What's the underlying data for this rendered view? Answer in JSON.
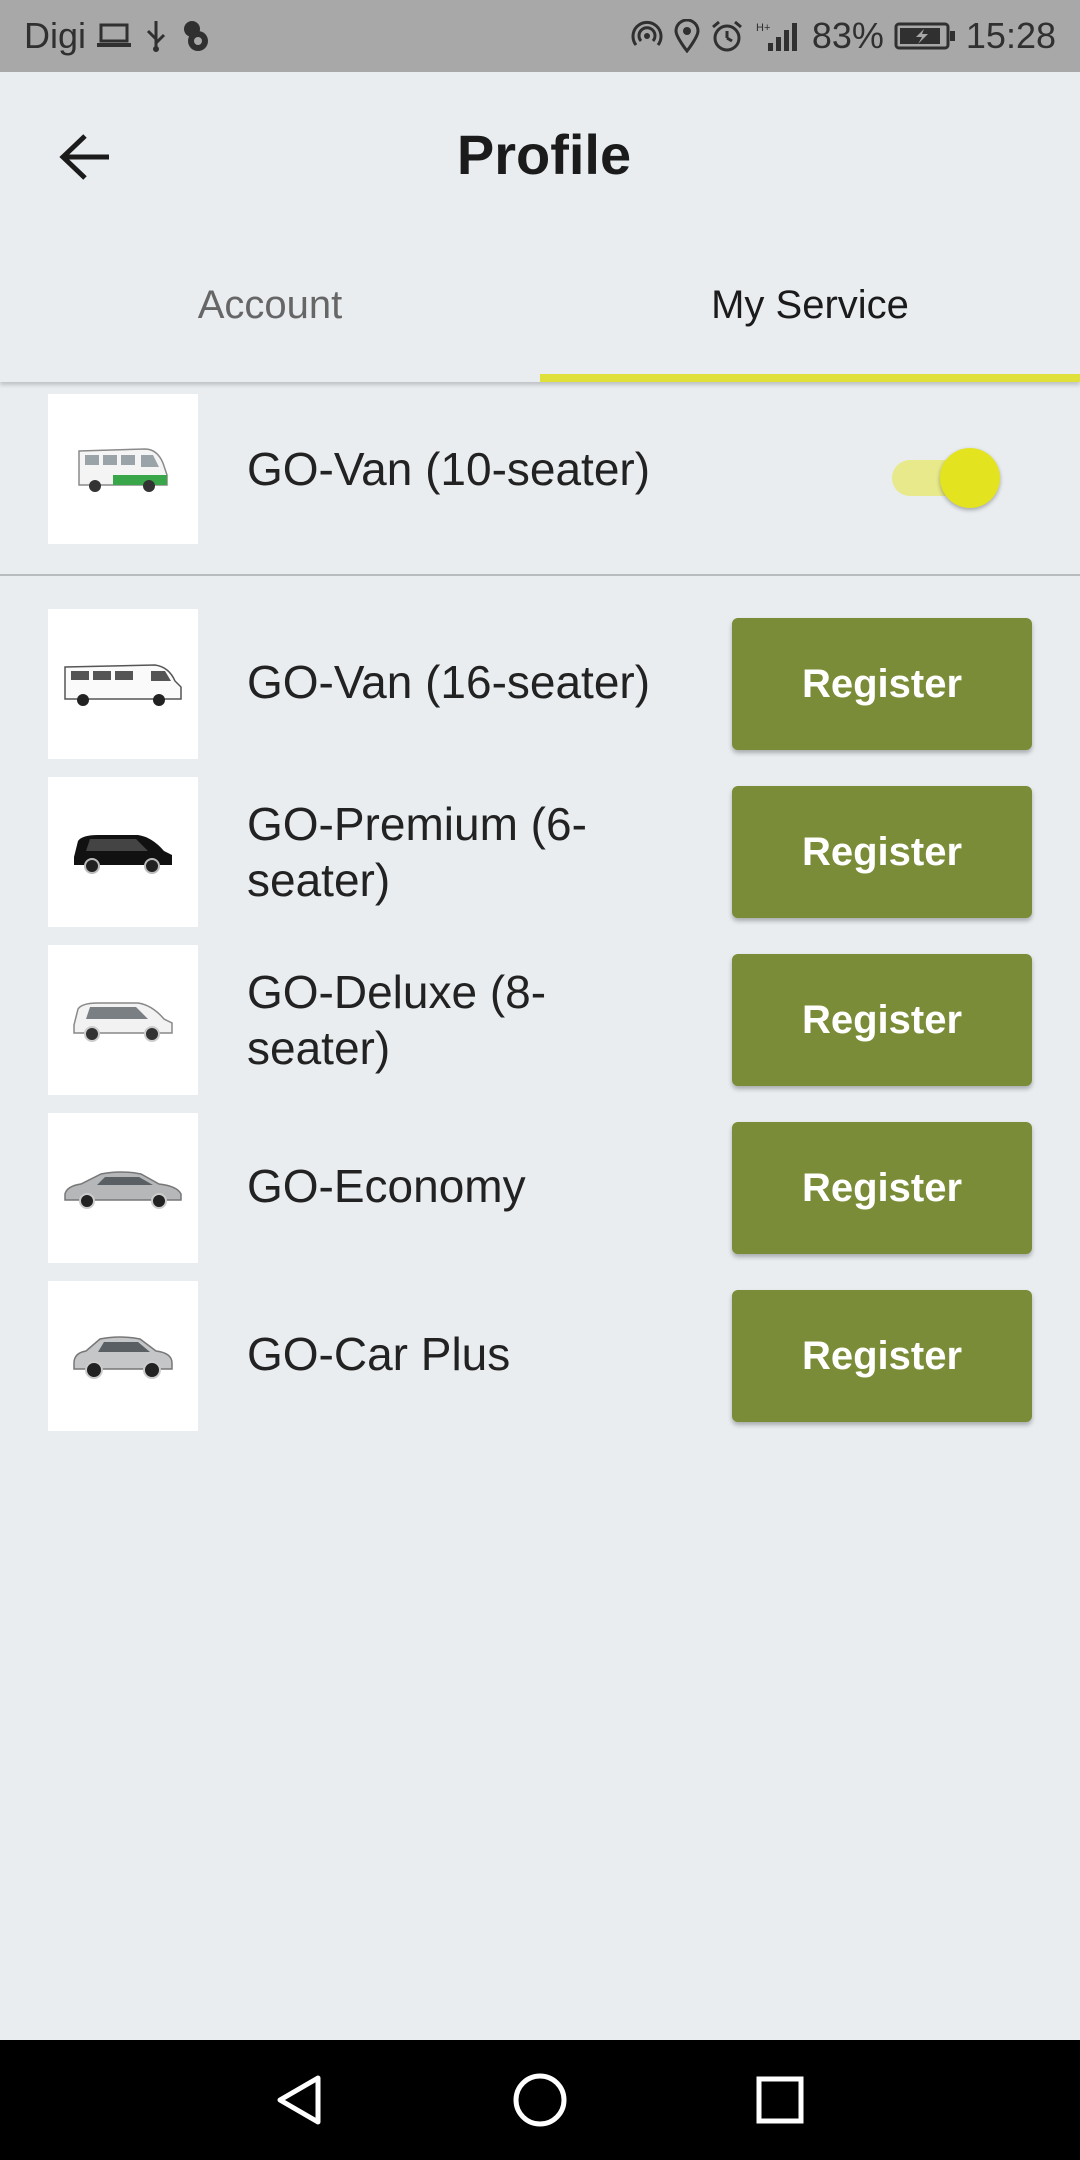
{
  "status_bar": {
    "carrier": "Digi",
    "battery": "83%",
    "time": "15:28",
    "background": "#a8a8a8"
  },
  "header": {
    "title": "Profile",
    "back_icon": "arrow-left-icon"
  },
  "tabs": [
    {
      "label": "Account",
      "selected": false
    },
    {
      "label": "My Service",
      "selected": true
    }
  ],
  "accent_color": "#dfe03a",
  "active_service": {
    "name": "GO-Van (10-seater)",
    "enabled": true,
    "icon": "van-10-seater-image"
  },
  "services": [
    {
      "name": "GO-Van (16-seater)",
      "button": "Register",
      "icon": "van-16-seater-image"
    },
    {
      "name": "GO-Premium (6-seater)",
      "button": "Register",
      "icon": "premium-minivan-image"
    },
    {
      "name": "GO-Deluxe (8-seater)",
      "button": "Register",
      "icon": "deluxe-minivan-image"
    },
    {
      "name": "GO-Economy",
      "button": "Register",
      "icon": "sedan-image"
    },
    {
      "name": "GO-Car Plus",
      "button": "Register",
      "icon": "suv-image"
    }
  ],
  "button_color": "#7a8c37",
  "nav_bar": [
    "back-triangle-icon",
    "home-circle-icon",
    "recents-square-icon"
  ]
}
